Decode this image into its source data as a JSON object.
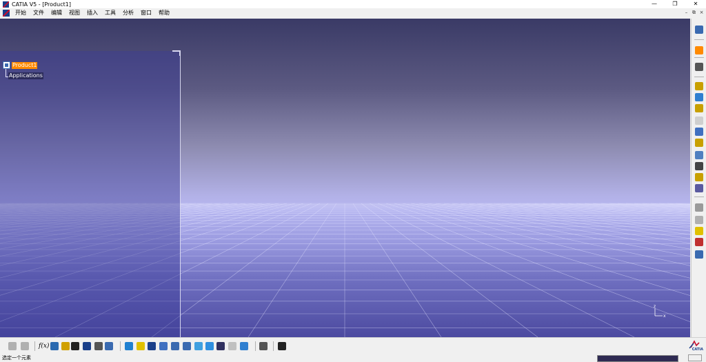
{
  "window": {
    "title": "CATIA V5 - [Product1]",
    "minimize_glyph": "—",
    "restore_glyph": "❐",
    "close_glyph": "✕"
  },
  "doc_controls": {
    "minimize_glyph": "–",
    "restore_glyph": "⧉",
    "close_glyph": "×"
  },
  "menu": {
    "items": [
      "开始",
      "文件",
      "编辑",
      "视图",
      "插入",
      "工具",
      "分析",
      "窗口",
      "帮助"
    ]
  },
  "tree": {
    "root_label": "Product1",
    "child_label": "Applications"
  },
  "compass": {
    "z_label": "z",
    "x_label": "x"
  },
  "toolbar_bottom": {
    "formula_label": "f(x)"
  },
  "brand": {
    "logo_text": "CATIA"
  },
  "status": {
    "message": "选定一个元素"
  },
  "colors": {
    "selection_highlight": "#ff8a00",
    "viewport_top": "#3a3a66",
    "viewport_horizon": "#b6b6f0",
    "viewport_bottom": "#4c4aa0"
  },
  "icons": {
    "right_toolbar": [
      "plm-access-icon",
      "select-icon",
      "compass-icon",
      "component-insert-icon",
      "existing-component-icon",
      "existing-positioning-icon",
      "replace-component-icon",
      "graph-tree-reorder-icon",
      "generate-numbering-icon",
      "selective-load-icon",
      "manage-representations-icon",
      "multi-instantiation-icon",
      "fast-multi-instantiation-icon",
      "reorder-icon",
      "constraint-icon",
      "snap-icon",
      "explode-icon",
      "light-bulb-icon",
      "clash-icon"
    ],
    "bottom_toolbar": [
      "undo-icon",
      "redo-icon",
      "formula-icon",
      "comment-icon",
      "lamp-icon",
      "table-icon",
      "hierarchy-icon",
      "capture-icon",
      "measure-icon",
      "fly-mode-icon",
      "fit-all-icon",
      "pan-icon",
      "rotate-icon",
      "zoom-in-icon",
      "zoom-out-icon",
      "normal-view-icon",
      "iso-view-icon",
      "shading-icon",
      "hide-show-icon",
      "swap-space-icon",
      "properties-icon",
      "camera-icon"
    ]
  }
}
